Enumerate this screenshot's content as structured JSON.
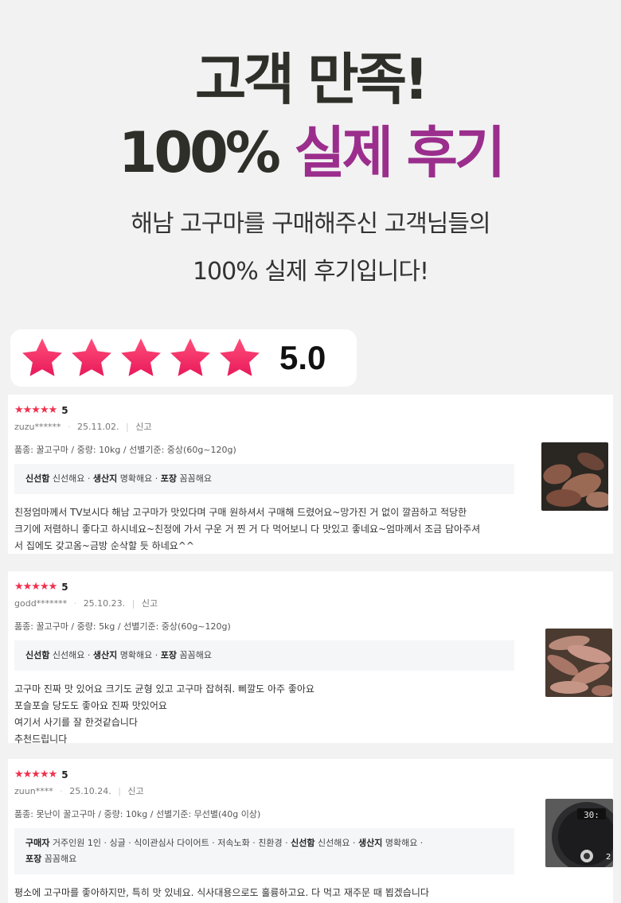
{
  "hero": {
    "title_line1": "고객 만족!",
    "title_line2_prefix": "100%",
    "title_line2_accent": "실제 후기",
    "sub_line1": "해남 고구마를 구매해주신 고객님들의",
    "sub_line2": "100% 실제 후기입니다!"
  },
  "rating": {
    "score": "5.0",
    "stars": 5
  },
  "colors": {
    "accent": "#9b2e8c",
    "star": "#f0314f"
  },
  "reviews": [
    {
      "stars": "★★★★★",
      "score": "5",
      "user": "zuzu******",
      "date": "25.11.02.",
      "report": "신고",
      "options": "품종: 꿀고구마 / 중량: 10kg / 선별기준: 중상(60g~120g)",
      "tags": [
        {
          "label": "신선함",
          "value": "신선해요"
        },
        {
          "label": "생산지",
          "value": "명확해요"
        },
        {
          "label": "포장",
          "value": "꼼꼼해요"
        }
      ],
      "body": [
        "친정엄마께서 TV보시다 해남 고구마가 맛있다며 구매 원하셔서 구매해 드렸어요~망가진 거 없이 깔끔하고 적당한",
        "크기에 저렴하니 좋다고 하시네요~친정에 가서 구운 거 찐 거 다 먹어보니 다 맛있고 좋네요~엄마께서 조금 담아주셔",
        "서 집에도 갖고옴~금방 순삭할 듯 하네요^^"
      ]
    },
    {
      "stars": "★★★★★",
      "score": "5",
      "user": "godd*******",
      "date": "25.10.23.",
      "report": "신고",
      "options": "품종: 꿀고구마 / 중량: 5kg / 선별기준: 중상(60g~120g)",
      "tags": [
        {
          "label": "신선함",
          "value": "신선해요"
        },
        {
          "label": "생산지",
          "value": "명확해요"
        },
        {
          "label": "포장",
          "value": "꼼꼼해요"
        }
      ],
      "body": [
        "고구마 진짜 맛 있어요 크기도 균형 있고 고구마 잡혀줘. 삐깔도 아주 좋아요",
        "포슬포슬 당도도 좋아요 진짜 맛있어요",
        "여기서 사기를 잘 한것같습니다",
        "추천드립니다"
      ]
    },
    {
      "stars": "★★★★★",
      "score": "5",
      "user": "zuun****",
      "date": "25.10.24.",
      "report": "신고",
      "options": "품종: 못난이 꿀고구마 / 중량: 10kg / 선별기준: 무선별(40g 이상)",
      "tags_line1": [
        {
          "label": "구매자",
          "value": "거주인원 1인 · 싱글 · 식이관심사 다이어트 · 저속노화 · 친환경"
        },
        {
          "label": "신선함",
          "value": "신선해요"
        },
        {
          "label": "생산지",
          "value": "명확해요"
        }
      ],
      "tags_line2": [
        {
          "label": "포장",
          "value": "꼼꼼해요"
        }
      ],
      "body": [
        "평소에 고구마를 좋아하지만, 특히 맛 있네요. 식사대용으로도 훌륭하고요. 다 먹고 재주문 때 뵙겠습니다"
      ],
      "thumb_display": "30:",
      "thumb_badge": "2"
    }
  ]
}
